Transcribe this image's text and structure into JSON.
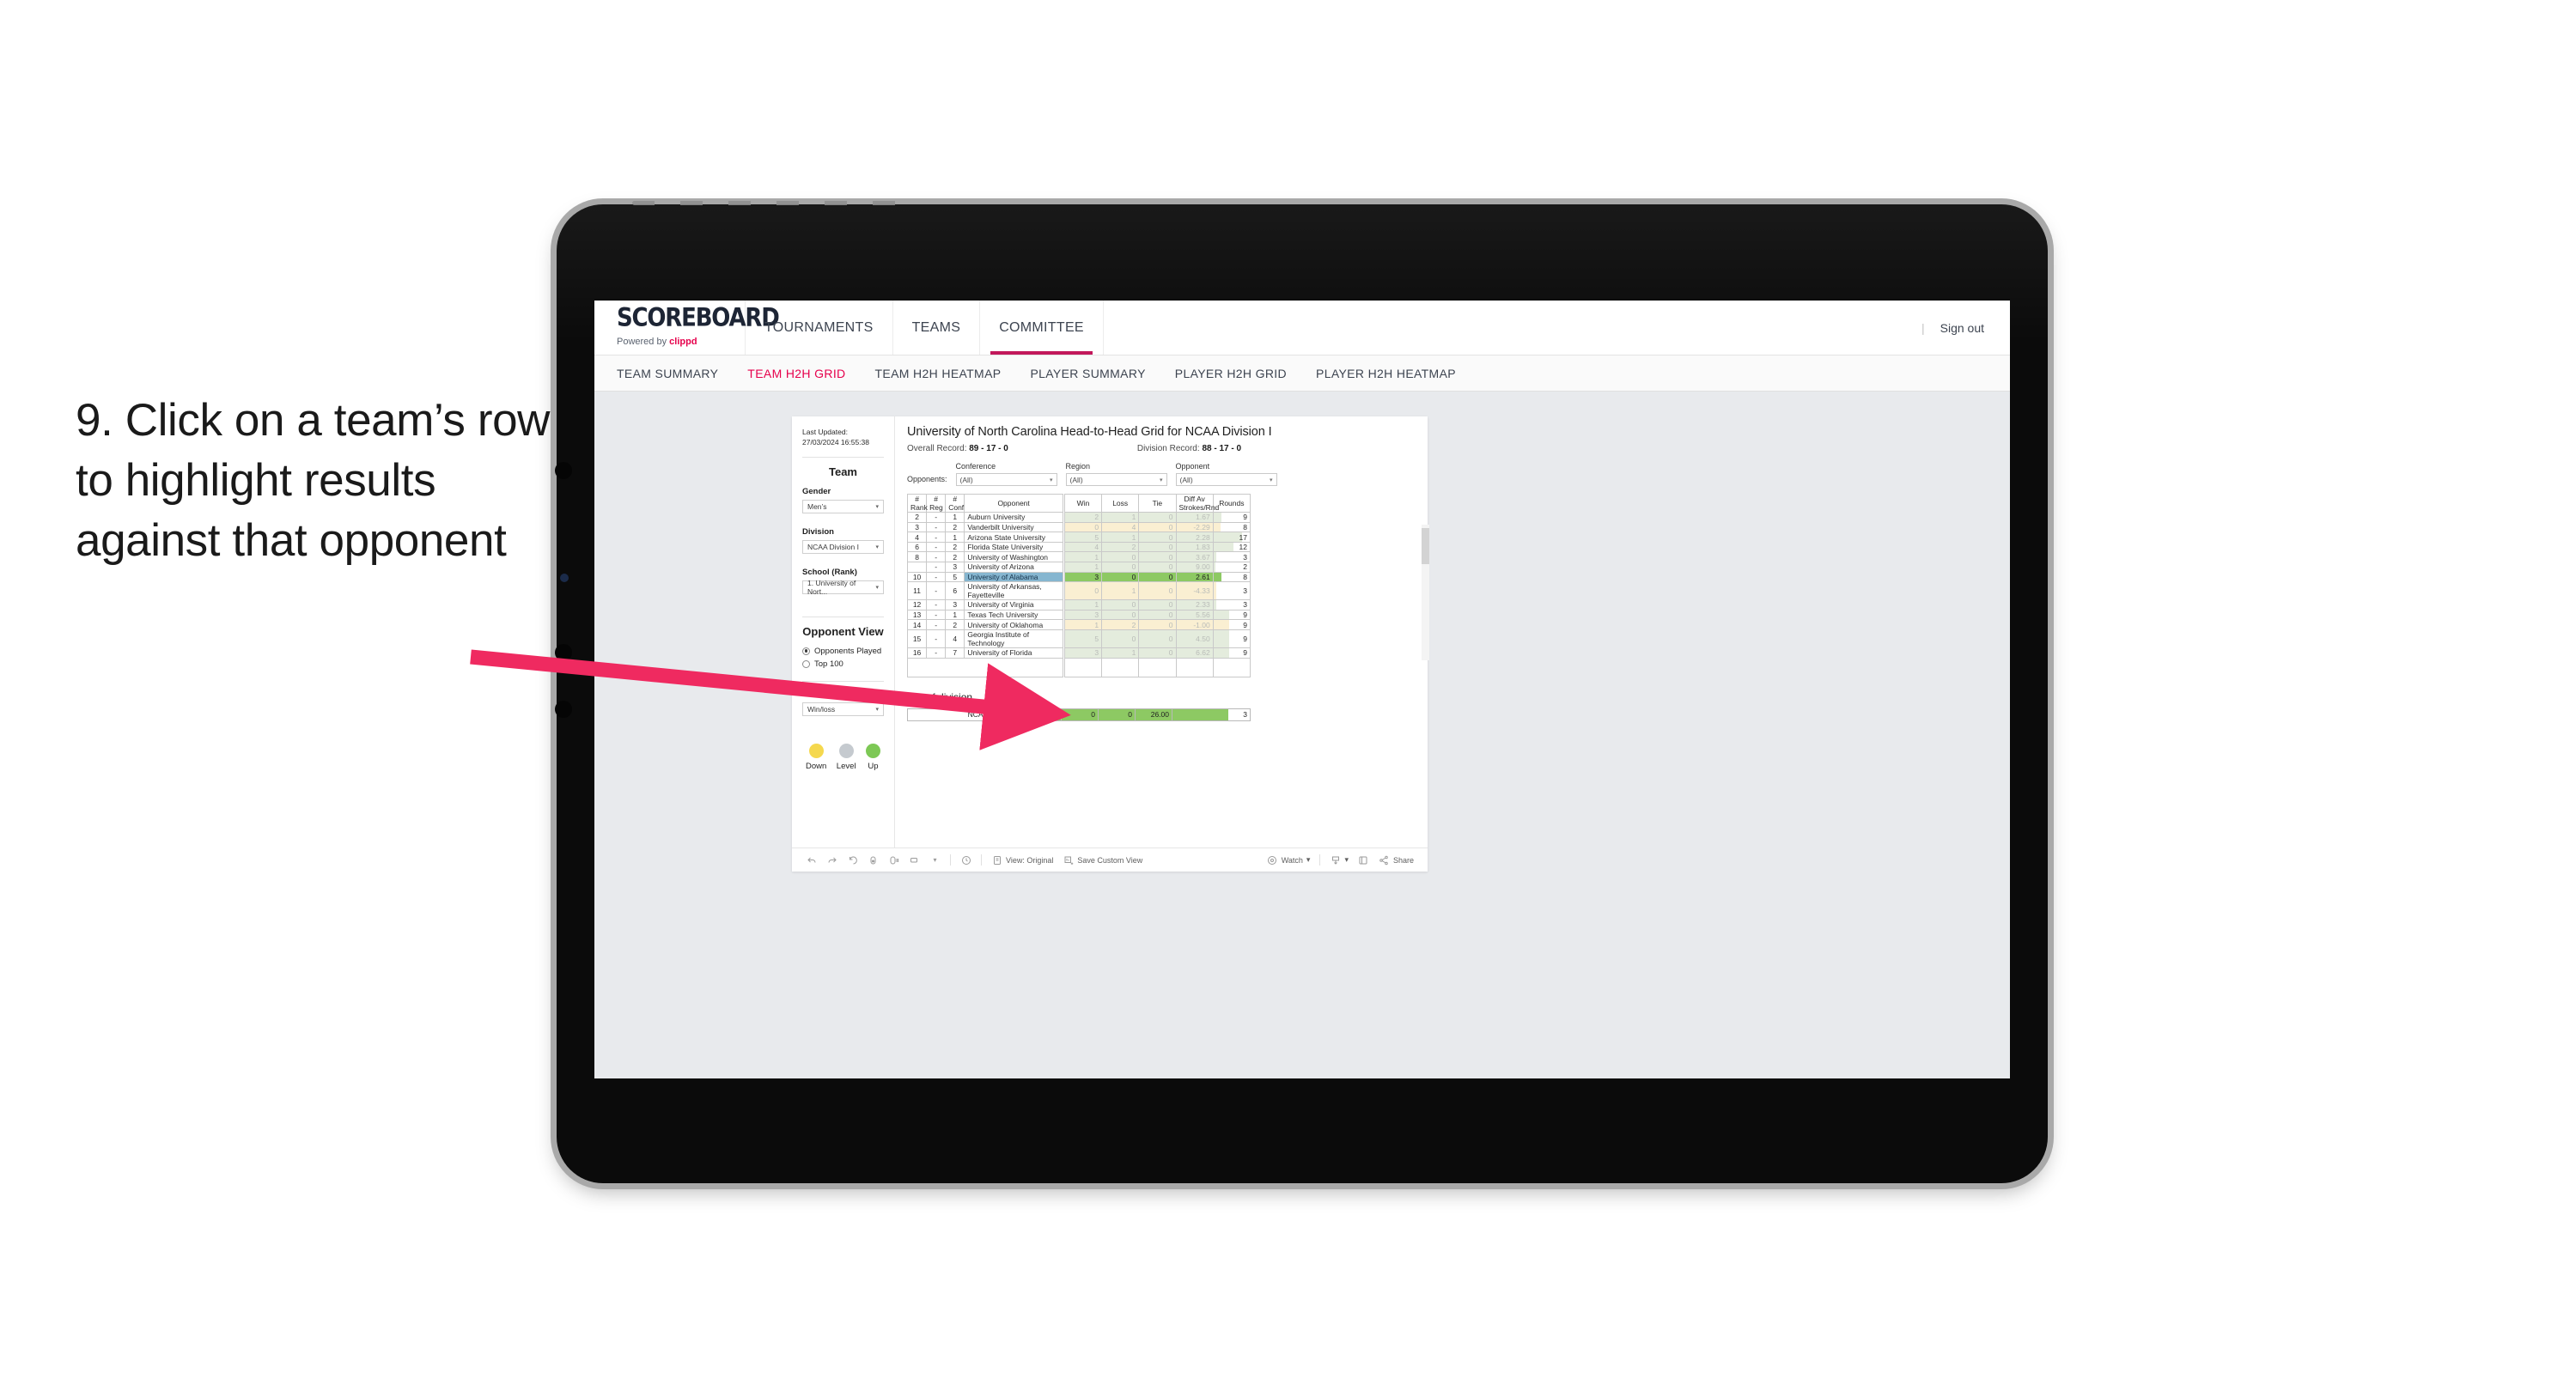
{
  "caption": "9. Click on a team’s row to highlight results against that opponent",
  "brand": {
    "title": "SCOREBOARD",
    "powered_prefix": "Powered by",
    "powered_name": "clippd"
  },
  "topnav": {
    "items": [
      "TOURNAMENTS",
      "TEAMS",
      "COMMITTEE"
    ],
    "active": "COMMITTEE",
    "separator": "|",
    "sign_out": "Sign out"
  },
  "subnav": {
    "items": [
      "TEAM SUMMARY",
      "TEAM H2H GRID",
      "TEAM H2H HEATMAP",
      "PLAYER SUMMARY",
      "PLAYER H2H GRID",
      "PLAYER H2H HEATMAP"
    ],
    "active": "TEAM H2H GRID"
  },
  "sidebar": {
    "last_updated": "Last Updated: 27/03/2024 16:55:38",
    "team_heading": "Team",
    "gender_label": "Gender",
    "gender_value": "Men’s",
    "division_label": "Division",
    "division_value": "NCAA Division I",
    "school_label": "School (Rank)",
    "school_value": "1. University of Nort...",
    "opponent_view_heading": "Opponent View",
    "opponent_view_options": [
      "Opponents Played",
      "Top 100"
    ],
    "opponent_view_selected": "Opponents Played",
    "colour_by_label": "Colour by",
    "colour_by_value": "Win/loss",
    "legend": [
      {
        "label": "Down",
        "color": "#f5d84e"
      },
      {
        "label": "Level",
        "color": "#c5cacf"
      },
      {
        "label": "Up",
        "color": "#7dc855"
      }
    ]
  },
  "view": {
    "title": "University of North Carolina Head-to-Head Grid for NCAA Division I",
    "overall_record_label": "Overall Record:",
    "overall_record_value": "89 - 17 - 0",
    "division_record_label": "Division Record:",
    "division_record_value": "88 - 17 - 0",
    "opponents_label": "Opponents:",
    "filters": [
      {
        "caption": "Conference",
        "value": "(All)"
      },
      {
        "caption": "Region",
        "value": "(All)"
      },
      {
        "caption": "Opponent",
        "value": "(All)"
      }
    ]
  },
  "chart_data": {
    "type": "table",
    "title": "University of North Carolina Head-to-Head Grid for NCAA Division I",
    "columns": [
      "# Rank",
      "# Reg",
      "# Conf",
      "Opponent",
      "Win",
      "Loss",
      "Tie",
      "Diff Av Strokes/Rnd",
      "Rounds"
    ],
    "rows": [
      {
        "rank": "2",
        "reg": "-",
        "conf": "1",
        "opponent": "Auburn University",
        "win": "2",
        "loss": "1",
        "tie": "0",
        "diff": "1.67",
        "rounds": "9",
        "state": "up",
        "bar": 22
      },
      {
        "rank": "3",
        "reg": "-",
        "conf": "2",
        "opponent": "Vanderbilt University",
        "win": "0",
        "loss": "4",
        "tie": "0",
        "diff": "-2.29",
        "rounds": "8",
        "state": "down",
        "bar": 19
      },
      {
        "rank": "4",
        "reg": "-",
        "conf": "1",
        "opponent": "Arizona State University",
        "win": "5",
        "loss": "1",
        "tie": "0",
        "diff": "2.28",
        "rounds": "17",
        "state": "up",
        "bar": 78
      },
      {
        "rank": "6",
        "reg": "-",
        "conf": "2",
        "opponent": "Florida State University",
        "win": "4",
        "loss": "2",
        "tie": "0",
        "diff": "1.83",
        "rounds": "12",
        "state": "up",
        "bar": 56
      },
      {
        "rank": "8",
        "reg": "-",
        "conf": "2",
        "opponent": "University of Washington",
        "win": "1",
        "loss": "0",
        "tie": "0",
        "diff": "3.67",
        "rounds": "3",
        "state": "up",
        "bar": 8
      },
      {
        "rank": "",
        "reg": "-",
        "conf": "3",
        "opponent": "University of Arizona",
        "win": "1",
        "loss": "0",
        "tie": "0",
        "diff": "9.00",
        "rounds": "2",
        "state": "up",
        "bar": 6
      },
      {
        "rank": "10",
        "reg": "-",
        "conf": "5",
        "opponent": "University of Alabama",
        "win": "3",
        "loss": "0",
        "tie": "0",
        "diff": "2.61",
        "rounds": "8",
        "state": "highlight",
        "bar": 22
      },
      {
        "rank": "11",
        "reg": "-",
        "conf": "6",
        "opponent": "University of Arkansas, Fayetteville",
        "win": "0",
        "loss": "1",
        "tie": "0",
        "diff": "-4.33",
        "rounds": "3",
        "state": "down",
        "bar": 8
      },
      {
        "rank": "12",
        "reg": "-",
        "conf": "3",
        "opponent": "University of Virginia",
        "win": "1",
        "loss": "0",
        "tie": "0",
        "diff": "2.33",
        "rounds": "3",
        "state": "up",
        "bar": 8
      },
      {
        "rank": "13",
        "reg": "-",
        "conf": "1",
        "opponent": "Texas Tech University",
        "win": "3",
        "loss": "0",
        "tie": "0",
        "diff": "5.56",
        "rounds": "9",
        "state": "up",
        "bar": 44
      },
      {
        "rank": "14",
        "reg": "-",
        "conf": "2",
        "opponent": "University of Oklahoma",
        "win": "1",
        "loss": "2",
        "tie": "0",
        "diff": "-1.00",
        "rounds": "9",
        "state": "down",
        "bar": 44
      },
      {
        "rank": "15",
        "reg": "-",
        "conf": "4",
        "opponent": "Georgia Institute of Technology",
        "win": "5",
        "loss": "0",
        "tie": "0",
        "diff": "4.50",
        "rounds": "9",
        "state": "up",
        "bar": 44
      },
      {
        "rank": "16",
        "reg": "-",
        "conf": "7",
        "opponent": "University of Florida",
        "win": "3",
        "loss": "1",
        "tie": "0",
        "diff": "6.62",
        "rounds": "9",
        "state": "up",
        "bar": 44
      }
    ],
    "selected_row": "University of Alabama",
    "out_of_division": {
      "heading": "Out of division",
      "label": "NCAA Division II",
      "win": "1",
      "loss": "0",
      "tie": "0",
      "diff": "26.00",
      "rounds": "3",
      "bar": 72
    }
  },
  "headers": {
    "rank": "#\nRank",
    "rank_l1": "#",
    "rank_l2": "Rank",
    "reg_l2": "Reg",
    "conf_l2": "Conf",
    "opponent": "Opponent",
    "win": "Win",
    "loss": "Loss",
    "tie": "Tie",
    "diff_l1": "Diff Av",
    "diff_l2": "Strokes/Rnd",
    "rounds": "Rounds"
  },
  "toolbar": {
    "view_original": "View: Original",
    "save_custom_view": "Save Custom View",
    "watch": "Watch",
    "share": "Share",
    "caret": "▾"
  },
  "colors": {
    "accent": "#e6004c",
    "tab_underline": "#c2185b",
    "up_fill": "#e4ecdd",
    "down_fill": "#faefd2",
    "highlight_green": "#8dc963",
    "highlight_blue": "#86b6d0",
    "arrow": "#ef2a60"
  }
}
